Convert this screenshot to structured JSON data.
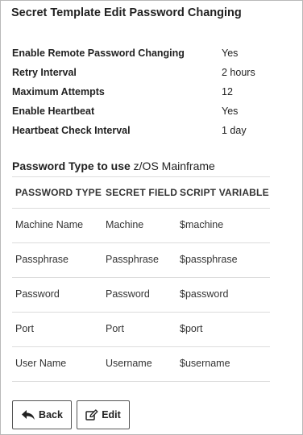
{
  "header": {
    "title": "Secret Template Edit Password Changing"
  },
  "settings": [
    {
      "label": "Enable Remote Password Changing",
      "value": "Yes"
    },
    {
      "label": "Retry Interval",
      "value": "2 hours"
    },
    {
      "label": "Maximum Attempts",
      "value": "12"
    },
    {
      "label": "Enable Heartbeat",
      "value": "Yes"
    },
    {
      "label": "Heartbeat Check Interval",
      "value": "1 day"
    }
  ],
  "password_type": {
    "prefix": "Password Type to use",
    "value": "z/OS Mainframe"
  },
  "table": {
    "columns": [
      "PASSWORD TYPE",
      "SECRET FIELD",
      "SCRIPT VARIABLE"
    ],
    "rows": [
      [
        "Machine Name",
        "Machine",
        "$machine"
      ],
      [
        "Passphrase",
        "Passphrase",
        "$passphrase"
      ],
      [
        "Password",
        "Password",
        "$password"
      ],
      [
        "Port",
        "Port",
        "$port"
      ],
      [
        "User Name",
        "Username",
        "$username"
      ]
    ]
  },
  "buttons": {
    "back": {
      "label": "Back",
      "icon": "reply-arrow-icon"
    },
    "edit": {
      "label": "Edit",
      "icon": "edit-icon"
    }
  }
}
